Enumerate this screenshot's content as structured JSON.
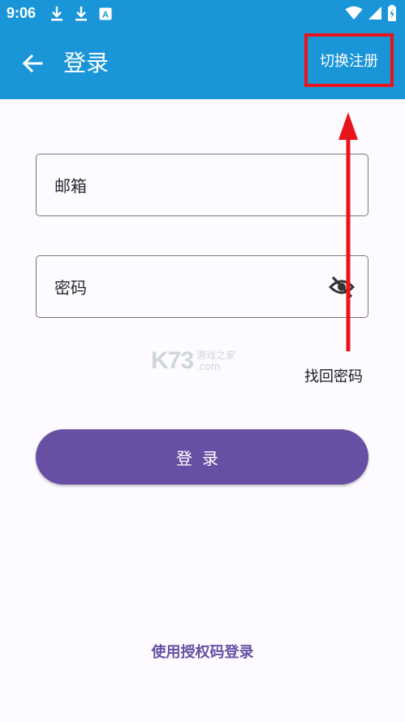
{
  "status_bar": {
    "time": "9:06",
    "left_icons": [
      "download-icon",
      "download-icon",
      "a-keyboard-icon"
    ],
    "right_icons": [
      "wifi-icon",
      "signal-icon",
      "battery-charging-icon"
    ]
  },
  "app_bar": {
    "back_icon": "arrow-left-icon",
    "title": "登录",
    "switch_label": "切换注册",
    "highlight_color": "#e8141c",
    "background": "#1a96d8"
  },
  "form": {
    "email_label": "邮箱",
    "password_label": "密码",
    "password_toggle_icon": "eye-off-icon",
    "forgot_label": "找回密码",
    "login_label": "登录",
    "login_color": "#6750a4"
  },
  "watermark": {
    "logo": "K73",
    "line1": "游戏之家",
    "line2": ".com"
  },
  "footer": {
    "auth_code_login": "使用授权码登录"
  },
  "annotation": {
    "arrow_color": "#e8141c"
  }
}
